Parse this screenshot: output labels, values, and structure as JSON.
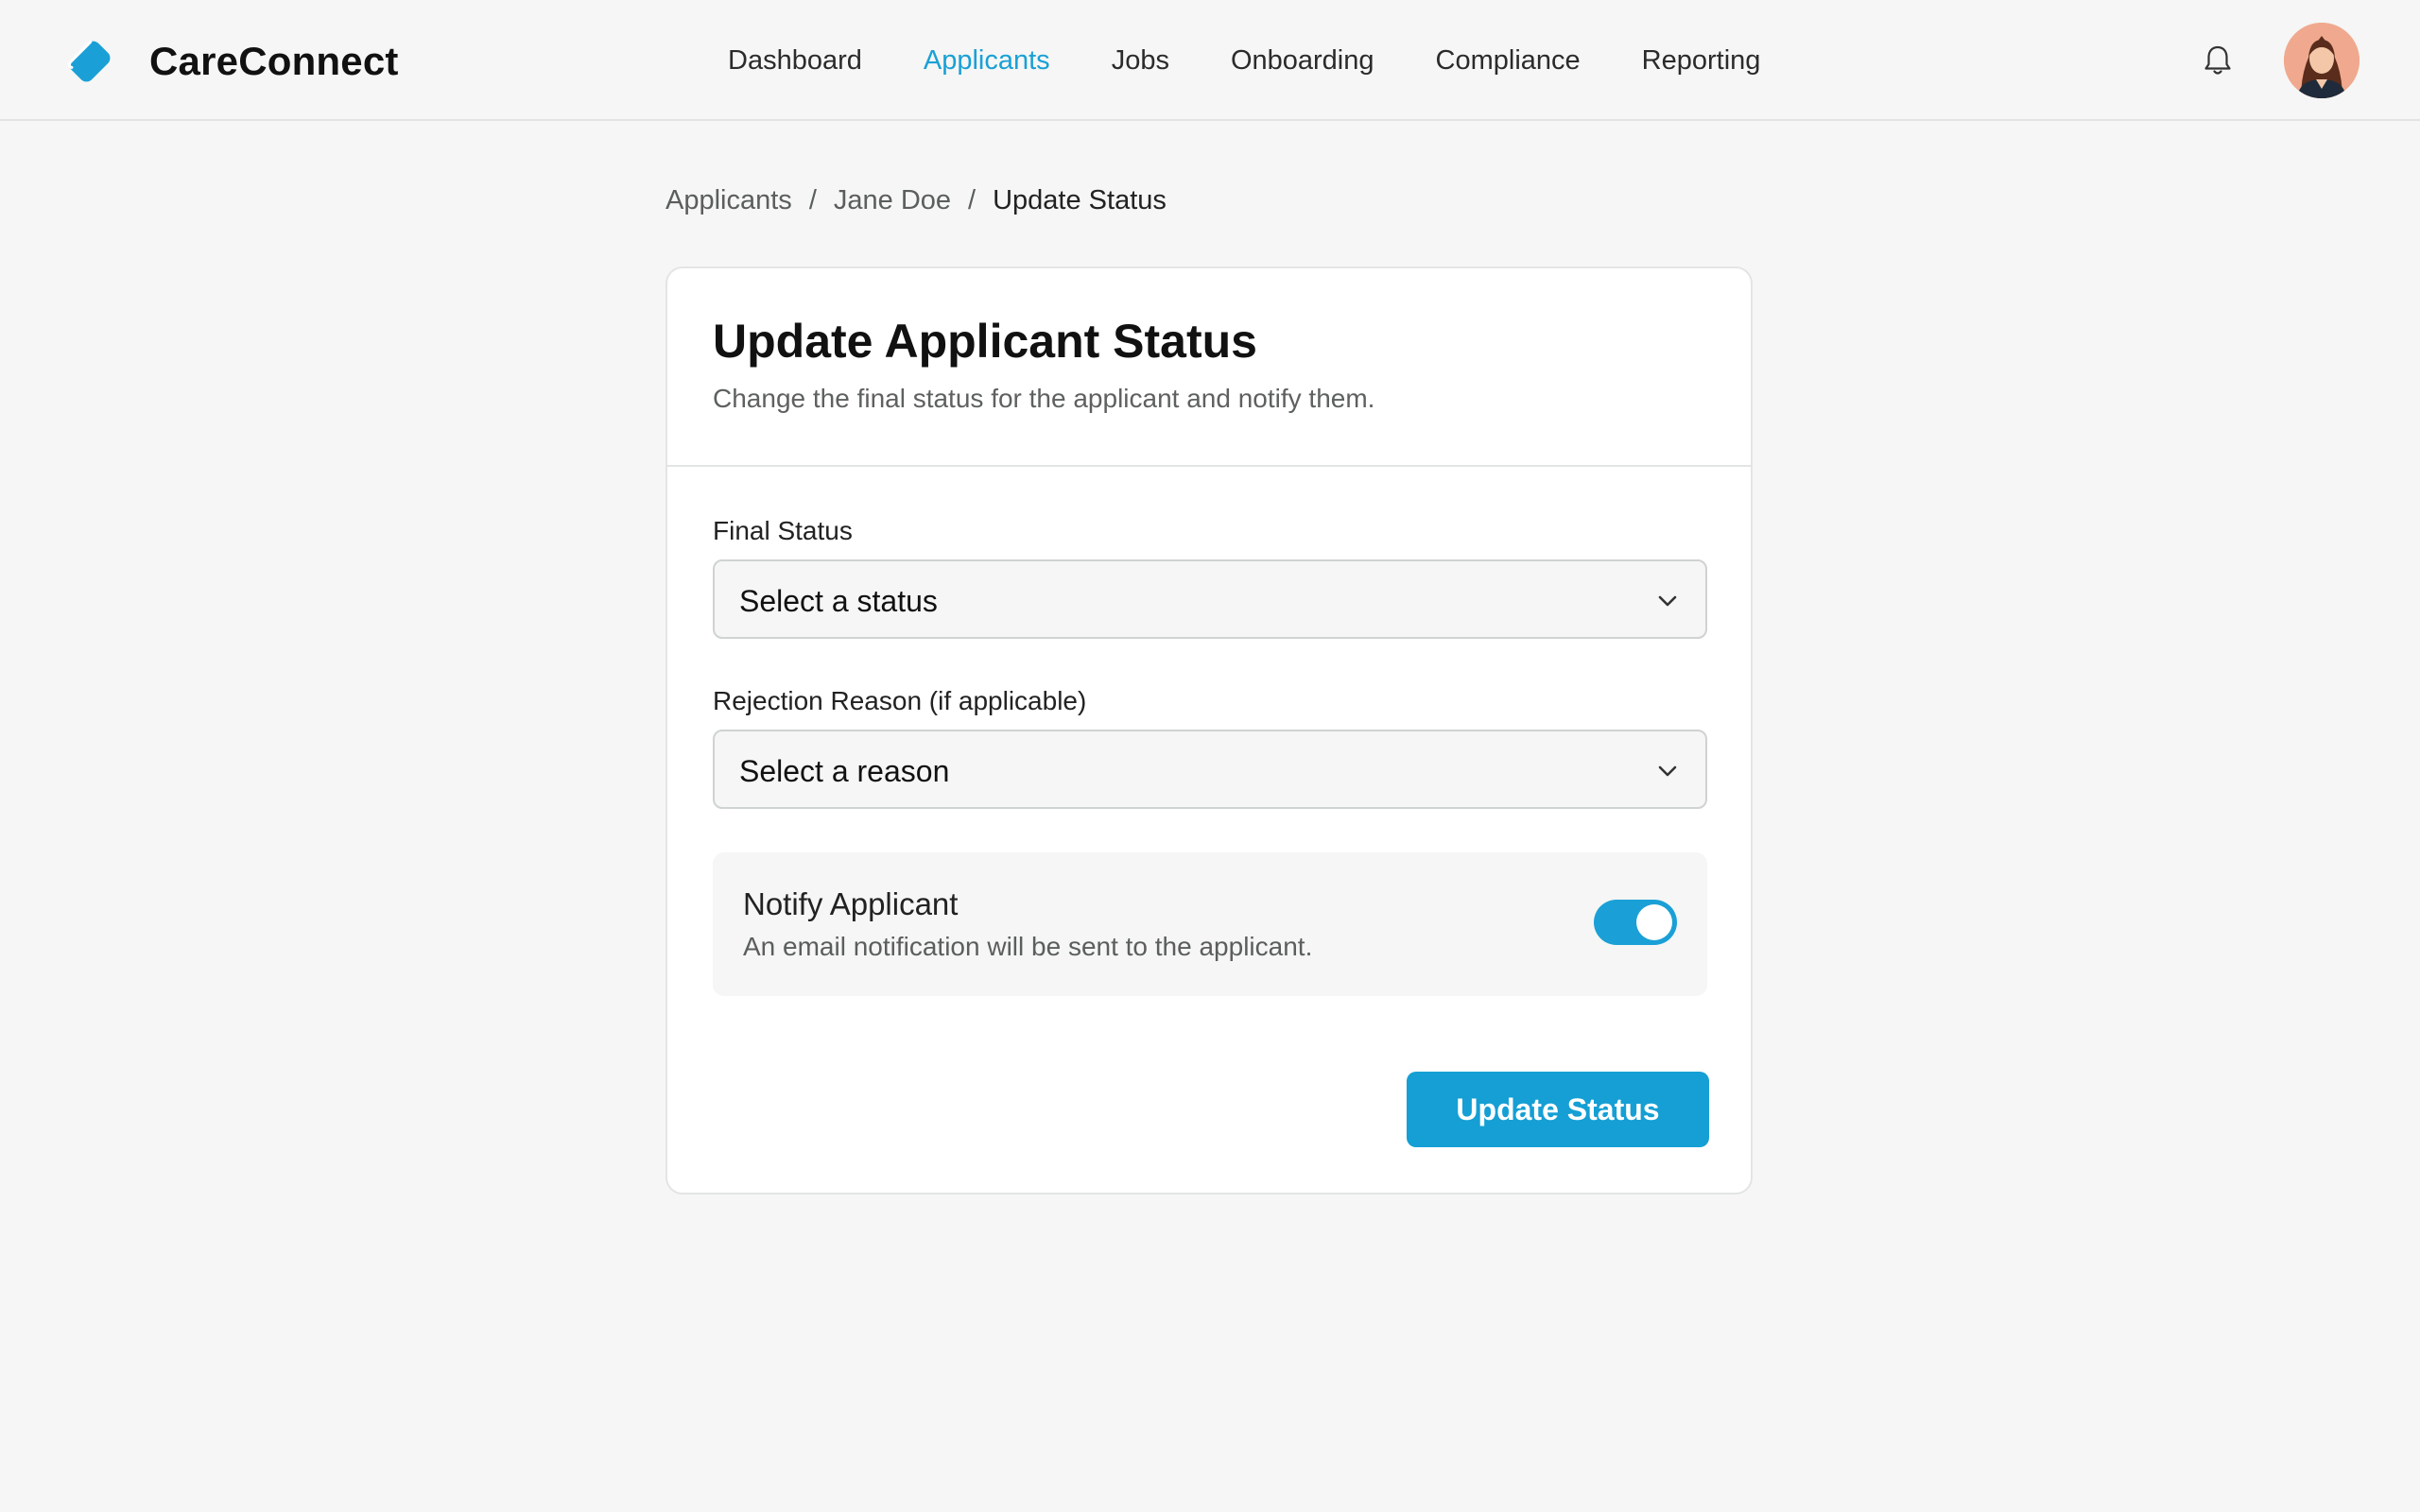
{
  "app": {
    "name": "CareConnect",
    "logo_icon": "tag-logo-icon",
    "accent_color": "#1aa0d6"
  },
  "nav": {
    "items": [
      {
        "label": "Dashboard",
        "active": false
      },
      {
        "label": "Applicants",
        "active": true
      },
      {
        "label": "Jobs",
        "active": false
      },
      {
        "label": "Onboarding",
        "active": false
      },
      {
        "label": "Compliance",
        "active": false
      },
      {
        "label": "Reporting",
        "active": false
      }
    ],
    "notification_icon": "bell-icon",
    "avatar_icon": "user-avatar"
  },
  "breadcrumb": {
    "items": [
      "Applicants",
      "Jane Doe",
      "Update Status"
    ],
    "separator": "/"
  },
  "form": {
    "title": "Update Applicant Status",
    "subtitle": "Change the final status for the applicant and notify them.",
    "final_status": {
      "label": "Final Status",
      "value": "Select a status"
    },
    "rejection_reason": {
      "label": "Rejection Reason (if applicable)",
      "value": "Select a reason"
    },
    "notify": {
      "title": "Notify Applicant",
      "description": "An email notification will be sent to the applicant.",
      "enabled": true
    },
    "submit_label": "Update Status"
  }
}
